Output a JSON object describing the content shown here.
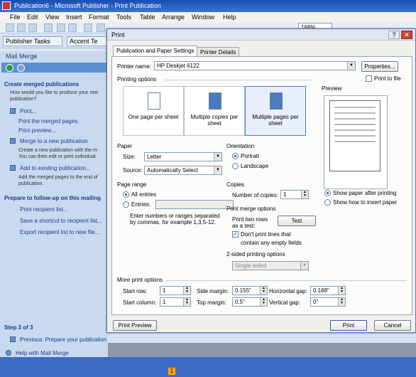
{
  "app": {
    "title": "Publication6 - Microsoft Publisher - Print Publication",
    "menus": [
      "File",
      "Edit",
      "View",
      "Insert",
      "Format",
      "Tools",
      "Table",
      "Arrange",
      "Window",
      "Help"
    ],
    "zoom": "168%",
    "tabs": [
      "Publisher Tasks",
      "Accent Te"
    ]
  },
  "taskpane": {
    "title": "Mail Merge",
    "section_create": "Create merged publications",
    "question": [
      "How would you like to produce your mer",
      "publication?"
    ],
    "print_link": "Print...",
    "print_desc1": "Print the merged pages.",
    "print_preview": "Print preview...",
    "merge_new": "Merge to a new publication",
    "merge_new_desc": [
      "Create a new publication with the m",
      "You can then edit or print individual"
    ],
    "add_existing": "Add to existing publication...",
    "add_existing_desc": [
      "Add the merged pages to the end of",
      "publication."
    ],
    "section_follow": "Prepare to follow-up on this mailing",
    "print_list": "Print recipient list...",
    "save_shortcut": "Save a shortcut to recipient list...",
    "export_list": "Export recipient list to new file...",
    "step": "Step 3 of 3",
    "previous": "Previous: Prepare your publication",
    "help": "Help with Mail Merge"
  },
  "dialog": {
    "title": "Print",
    "tab_pub": "Publication and Paper Settings",
    "tab_details": "Printer Details",
    "printer_name_label": "Printer name:",
    "printer_name": "HP Deskjet 6122",
    "properties": "Properties...",
    "print_to_file": "Print to file",
    "printing_options": "Printing options",
    "opt1": "One page per sheet",
    "opt2": "Multiple copies per sheet",
    "opt3": "Multiple pages per sheet",
    "preview": "Preview",
    "paper": "Paper",
    "size_label": "Size:",
    "size": "Letter",
    "source_label": "Source:",
    "source": "Automatically Select",
    "orientation": "Orientation",
    "portrait": "Portrait",
    "landscape": "Landscape",
    "page_range": "Page range",
    "all_entries": "All entries",
    "entries": "Entries:",
    "entries_hint": [
      "Enter numbers or ranges separated",
      "by commas, for example 1,3,5-12."
    ],
    "copies": "Copies",
    "num_copies_label": "Number of copies:",
    "num_copies": "1",
    "merge_options": "Print merge options",
    "print_two_rows": [
      "Print two rows",
      "as a test:"
    ],
    "test": "Test",
    "dont_print": "Don't print lines that",
    "dont_print2": "contain any empty fields",
    "two_sided": "2-sided printing options",
    "single_sided": "Single-sided",
    "show_paper": "Show paper after printing",
    "show_insert": "Show how to insert paper",
    "more_options": "More print options",
    "start_row_label": "Start row:",
    "start_row": "1",
    "start_col_label": "Start column:",
    "start_col": "1",
    "side_margin_label": "Side margin:",
    "side_margin": "0.155\"",
    "top_margin_label": "Top margin:",
    "top_margin": "0.5\"",
    "h_gap_label": "Horizontal gap:",
    "h_gap": "0.188\"",
    "v_gap_label": "Vertical gap:",
    "v_gap": "0\"",
    "print_preview": "Print Preview",
    "print": "Print",
    "cancel": "Cancel"
  },
  "page_badge": "1"
}
